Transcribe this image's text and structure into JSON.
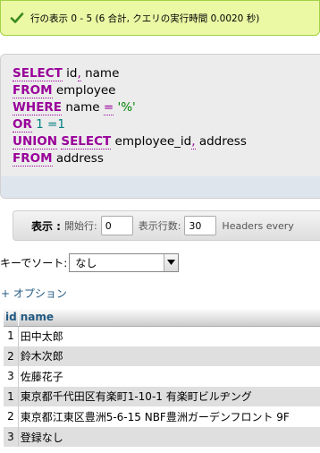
{
  "banner": {
    "message": "行の表示 0 - 5 (6 合計, クエリの実行時間 0.0020 秒)",
    "icon": "check-icon",
    "color": "#ebf8a4"
  },
  "sql": {
    "lines": [
      [
        {
          "t": "SELECT",
          "k": "kw"
        },
        {
          "t": " id",
          "k": "plain"
        },
        {
          "t": ",",
          "k": "op"
        },
        {
          "t": " name",
          "k": "plain"
        }
      ],
      [
        {
          "t": "FROM",
          "k": "kw"
        },
        {
          "t": " employee",
          "k": "plain"
        }
      ],
      [
        {
          "t": "WHERE",
          "k": "kw"
        },
        {
          "t": " name ",
          "k": "plain"
        },
        {
          "t": "=",
          "k": "op"
        },
        {
          "t": " ",
          "k": "plain"
        },
        {
          "t": "'%'",
          "k": "str"
        }
      ],
      [
        {
          "t": "OR",
          "k": "kw"
        },
        {
          "t": " 1 ",
          "k": "num"
        },
        {
          "t": "=1",
          "k": "num"
        }
      ],
      [
        {
          "t": "UNION",
          "k": "kw"
        },
        {
          "t": " ",
          "k": "plain"
        },
        {
          "t": "SELECT",
          "k": "kw"
        },
        {
          "t": " employee_id",
          "k": "plain"
        },
        {
          "t": ",",
          "k": "op"
        },
        {
          "t": " address",
          "k": "plain"
        }
      ],
      [
        {
          "t": "FROM",
          "k": "kw"
        },
        {
          "t": " address",
          "k": "plain"
        }
      ]
    ]
  },
  "nav": {
    "display_label": "表示 :",
    "start_row_label": "開始行:",
    "start_row_value": "0",
    "row_count_label": "表示行数:",
    "row_count_value": "30",
    "headers_label": "Headers every"
  },
  "sort": {
    "label": "キーでソート:",
    "selected": "なし"
  },
  "options_link": "+ オプション",
  "table": {
    "columns": [
      "id",
      "name"
    ],
    "rows": [
      [
        "1",
        "田中太郎"
      ],
      [
        "2",
        "鈴木次郎"
      ],
      [
        "3",
        "佐藤花子"
      ],
      [
        "1",
        "東京都千代田区有楽町1-10-1 有楽町ビルヂング"
      ],
      [
        "2",
        "東京都江東区豊洲5-6-15 NBF豊洲ガーデンフロント 9F"
      ],
      [
        "3",
        "登録なし"
      ]
    ]
  }
}
